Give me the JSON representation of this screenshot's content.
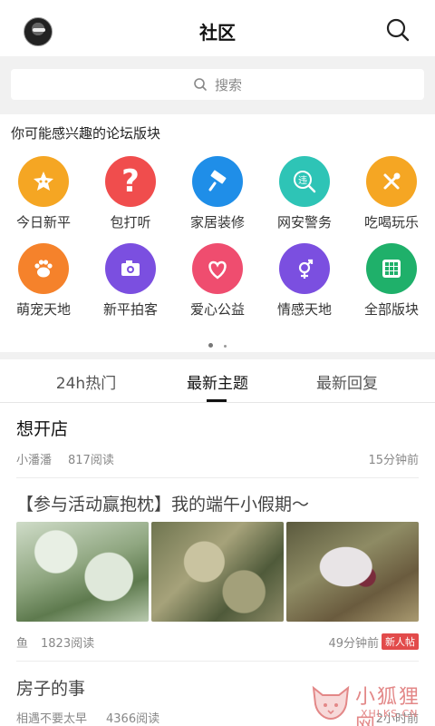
{
  "header": {
    "title": "社区"
  },
  "search": {
    "placeholder": "搜索"
  },
  "section": {
    "title": "你可能感兴趣的论坛版块"
  },
  "categories": [
    {
      "label": "今日新平",
      "color": "#f5a623",
      "icon": "star-chat-icon"
    },
    {
      "label": "包打听",
      "color": "#f04d4d",
      "icon": "question-icon"
    },
    {
      "label": "家居装修",
      "color": "#1f8ee8",
      "icon": "paint-roller-icon"
    },
    {
      "label": "网安警务",
      "color": "#2ec4b6",
      "icon": "police-icon"
    },
    {
      "label": "吃喝玩乐",
      "color": "#f5a623",
      "icon": "fork-spoon-icon"
    },
    {
      "label": "萌宠天地",
      "color": "#f5822b",
      "icon": "paw-icon"
    },
    {
      "label": "新平拍客",
      "color": "#7b4fe0",
      "icon": "camera-icon"
    },
    {
      "label": "爱心公益",
      "color": "#ef4d6f",
      "icon": "heart-icon"
    },
    {
      "label": "情感天地",
      "color": "#7b4fe0",
      "icon": "gender-icon"
    },
    {
      "label": "全部版块",
      "color": "#1fb06a",
      "icon": "grid-icon"
    }
  ],
  "tabs": [
    {
      "label": "24h热门"
    },
    {
      "label": "最新主题"
    },
    {
      "label": "最新回复"
    }
  ],
  "posts": [
    {
      "title": "想开店",
      "author": "小潘潘",
      "reads": "817阅读",
      "time": "15分钟前"
    },
    {
      "title": "【参与活动赢抱枕】我的端午小假期～",
      "author": "鱼",
      "reads": "1823阅读",
      "time": "49分钟前",
      "badge": "新人帖"
    },
    {
      "title": "房子的事",
      "author": "相遇不要太早",
      "reads": "4366阅读",
      "time": "2小时前"
    }
  ],
  "watermark": {
    "cn": "小狐狸网",
    "en": "XHLKS.CN"
  }
}
